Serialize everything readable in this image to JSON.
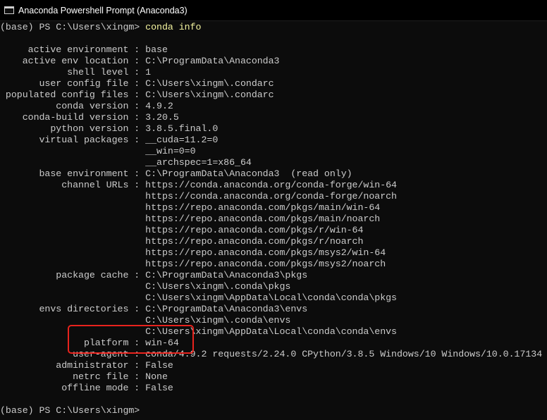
{
  "window": {
    "title": "Anaconda Powershell Prompt (Anaconda3)",
    "icon": "terminal-icon"
  },
  "colors": {
    "background": "#0c0c0c",
    "foreground": "#cccccc",
    "command": "#f5f5a0",
    "highlight": "#e8231d"
  },
  "console": {
    "prompt": "(base) PS C:\\Users\\xingm> ",
    "command": "conda info",
    "output_lines": [
      "",
      "     active environment : base",
      "    active env location : C:\\ProgramData\\Anaconda3",
      "            shell level : 1",
      "       user config file : C:\\Users\\xingm\\.condarc",
      " populated config files : C:\\Users\\xingm\\.condarc",
      "          conda version : 4.9.2",
      "    conda-build version : 3.20.5",
      "         python version : 3.8.5.final.0",
      "       virtual packages : __cuda=11.2=0",
      "                          __win=0=0",
      "                          __archspec=1=x86_64",
      "       base environment : C:\\ProgramData\\Anaconda3  (read only)",
      "           channel URLs : https://conda.anaconda.org/conda-forge/win-64",
      "                          https://conda.anaconda.org/conda-forge/noarch",
      "                          https://repo.anaconda.com/pkgs/main/win-64",
      "                          https://repo.anaconda.com/pkgs/main/noarch",
      "                          https://repo.anaconda.com/pkgs/r/win-64",
      "                          https://repo.anaconda.com/pkgs/r/noarch",
      "                          https://repo.anaconda.com/pkgs/msys2/win-64",
      "                          https://repo.anaconda.com/pkgs/msys2/noarch",
      "          package cache : C:\\ProgramData\\Anaconda3\\pkgs",
      "                          C:\\Users\\xingm\\.conda\\pkgs",
      "                          C:\\Users\\xingm\\AppData\\Local\\conda\\conda\\pkgs",
      "       envs directories : C:\\ProgramData\\Anaconda3\\envs",
      "                          C:\\Users\\xingm\\.conda\\envs",
      "                          C:\\Users\\xingm\\AppData\\Local\\conda\\conda\\envs",
      "               platform : win-64",
      "             user-agent : conda/4.9.2 requests/2.24.0 CPython/3.8.5 Windows/10 Windows/10.0.17134",
      "          administrator : False",
      "             netrc file : None",
      "           offline mode : False",
      ""
    ],
    "final_prompt": "(base) PS C:\\Users\\xingm>"
  }
}
